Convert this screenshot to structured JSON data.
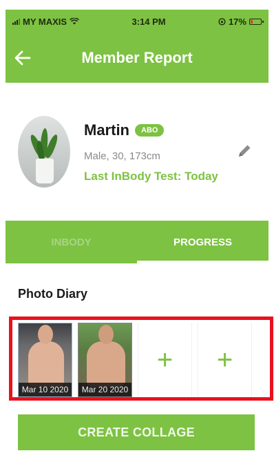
{
  "colors": {
    "accent": "#7dc242",
    "highlight": "#e8121d"
  },
  "status_bar": {
    "carrier": "MY MAXIS",
    "time": "3:14 PM",
    "battery": "17%",
    "icons": [
      "signal-icon",
      "wifi-icon",
      "orientation-lock-icon",
      "battery-icon"
    ]
  },
  "header": {
    "title": "Member Report",
    "back_icon": "arrow-left-icon"
  },
  "profile": {
    "name": "Martin",
    "badge": "ABO",
    "demographics": "Male, 30, 173cm",
    "last_test": "Last InBody Test: Today",
    "edit_icon": "pencil-icon"
  },
  "tabs": [
    {
      "label": "INBODY",
      "active": false
    },
    {
      "label": "PROGRESS",
      "active": true
    }
  ],
  "photo_diary": {
    "title": "Photo Diary",
    "photos": [
      {
        "date": "Mar 10 2020"
      },
      {
        "date": "Mar 20 2020"
      }
    ],
    "add_slots": [
      "+",
      "+"
    ]
  },
  "actions": {
    "create_collage": "CREATE COLLAGE"
  }
}
